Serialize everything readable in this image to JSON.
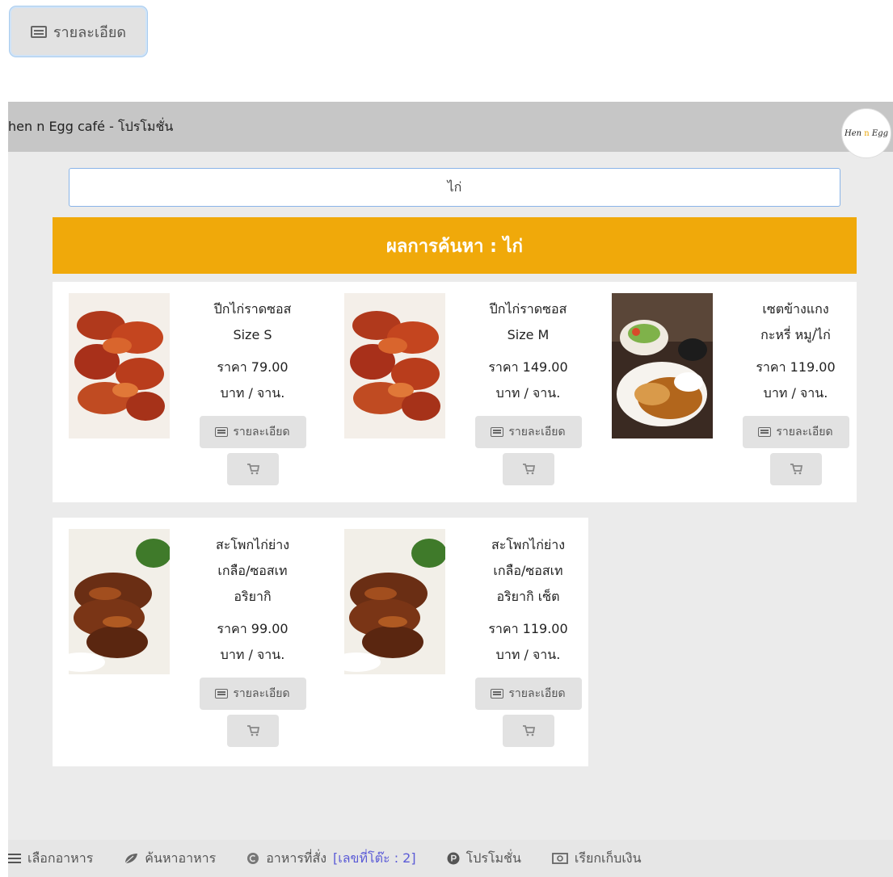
{
  "float_button": {
    "label": "รายละเอียด"
  },
  "panel": {
    "title": "hen n Egg café - โปรโมชั่น",
    "logo_text": "Hen n Egg"
  },
  "search": {
    "value": "ไก่"
  },
  "result_banner": "ผลการค้นหา : ไก่",
  "products": [
    {
      "name_line1": "ปีกไก่ราดซอส",
      "name_line2": "Size S",
      "name_line3": "",
      "price_line1": "ราคา 79.00",
      "price_line2": "บาท / จาน.",
      "detail_label": "รายละเอียด",
      "image": "chicken-wings"
    },
    {
      "name_line1": "ปีกไก่ราดซอส",
      "name_line2": "Size M",
      "name_line3": "",
      "price_line1": "ราคา 149.00",
      "price_line2": "บาท / จาน.",
      "detail_label": "รายละเอียด",
      "image": "chicken-wings"
    },
    {
      "name_line1": "เซตข้างแกง",
      "name_line2": "กะหรี่ หมู/ไก่",
      "name_line3": "",
      "price_line1": "ราคา 119.00",
      "price_line2": "บาท / จาน.",
      "detail_label": "รายละเอียด",
      "image": "curry-set"
    },
    {
      "name_line1": "สะโพกไก่ย่าง",
      "name_line2": "เกลือ/ซอสเท",
      "name_line3": "อริยากิ",
      "price_line1": "ราคา 99.00",
      "price_line2": "บาท / จาน.",
      "detail_label": "รายละเอียด",
      "image": "grilled-chicken"
    },
    {
      "name_line1": "สะโพกไก่ย่าง",
      "name_line2": "เกลือ/ซอสเท",
      "name_line3": "อริยากิ เซ็ต",
      "price_line1": "ราคา 119.00",
      "price_line2": "บาท / จาน.",
      "detail_label": "รายละเอียด",
      "image": "grilled-chicken"
    }
  ],
  "bottom_nav": {
    "choose_food": "เลือกอาหาร",
    "search_food": "ค้นหาอาหาร",
    "ordered_food": "อาหารที่สั่ง",
    "table_number": "[เลขที่โต๊ะ : 2]",
    "promotion": "โปรโมชั่น",
    "call_bill": "เรียกเก็บเงิน"
  },
  "colors": {
    "banner": "#f0a90a",
    "header": "#c6c6c6",
    "table_label": "#5b5bd6"
  }
}
